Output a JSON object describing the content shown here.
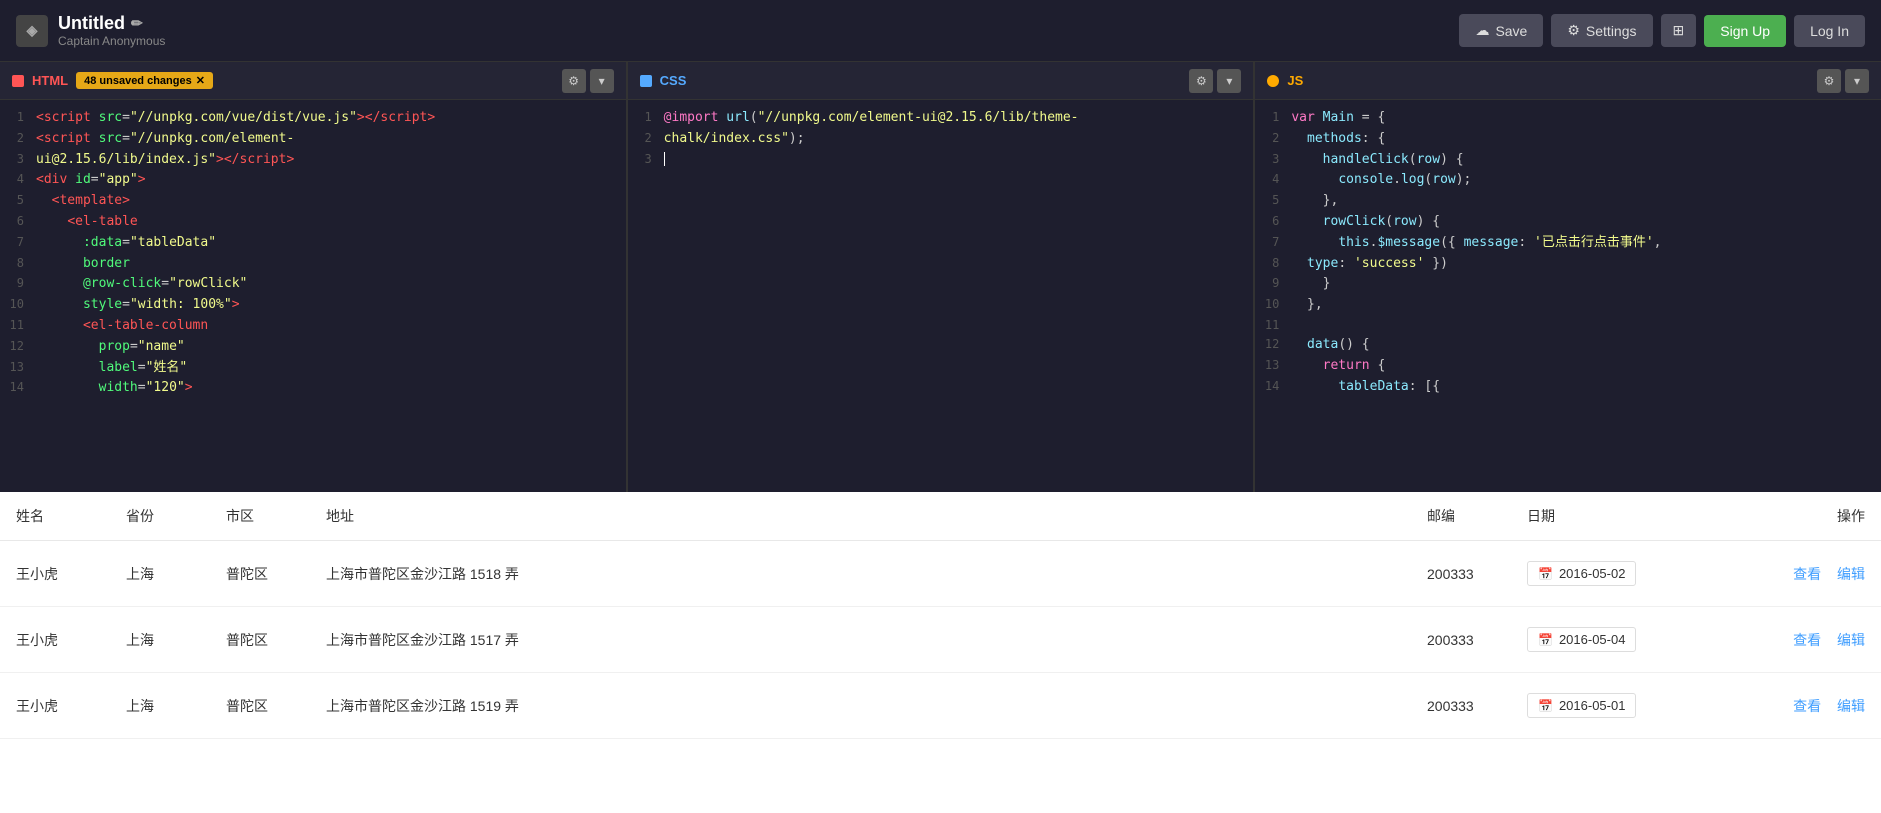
{
  "brand": {
    "logo": "◈",
    "title": "Untitled",
    "edit_icon": "✏",
    "subtitle": "Captain Anonymous"
  },
  "nav": {
    "save_label": "Save",
    "settings_label": "Settings",
    "signup_label": "Sign Up",
    "login_label": "Log In"
  },
  "panels": {
    "html": {
      "lang": "HTML",
      "unsaved_badge": "48 unsaved changes",
      "lines": [
        "<script src=\"//unpkg.com/vue/dist/vue.js\"><\\/script>",
        "<script src=\"//unpkg.com/element-",
        "ui@2.15.6/lib/index.js\"><\\/script>",
        "<div id=\"app\">",
        "  <template>",
        "    <el-table",
        "      :data=\"tableData\"",
        "      border",
        "      @row-click=\"rowClick\"",
        "      style=\"width: 100%\">",
        "      <el-table-column",
        "        prop=\"name\"",
        "        label=\"姓名\"",
        "        width=\"120\">"
      ]
    },
    "css": {
      "lang": "CSS",
      "lines": [
        "@import url(\"//unpkg.com/element-ui@2.15.6/lib/theme-",
        "chalk/index.css\");"
      ]
    },
    "js": {
      "lang": "JS",
      "lines": [
        "var Main = {",
        "  methods: {",
        "    handleClick(row) {",
        "      console.log(row);",
        "    },",
        "    rowClick(row) {",
        "      this.$message({ message: '已点击行点击事件',",
        "  type: 'success' })",
        "    }",
        "  },",
        "",
        "  data() {",
        "    return {",
        "      tableData: [{"
      ]
    }
  },
  "table": {
    "columns": [
      "姓名",
      "省份",
      "市区",
      "地址",
      "邮编",
      "日期",
      "",
      "操作"
    ],
    "rows": [
      {
        "name": "王小虎",
        "province": "上海",
        "city": "普陀区",
        "address": "上海市普陀区金沙江路 1518 弄",
        "zip": "200333",
        "date": "2016-05-02",
        "view": "查看",
        "edit": "编辑"
      },
      {
        "name": "王小虎",
        "province": "上海",
        "city": "普陀区",
        "address": "上海市普陀区金沙江路 1517 弄",
        "zip": "200333",
        "date": "2016-05-04",
        "view": "查看",
        "edit": "编辑"
      },
      {
        "name": "王小虎",
        "province": "上海",
        "city": "普陀区",
        "address": "上海市普陀区金沙江路 1519 弄",
        "zip": "200333",
        "date": "2016-05-01",
        "view": "查看",
        "edit": "编辑"
      }
    ]
  }
}
